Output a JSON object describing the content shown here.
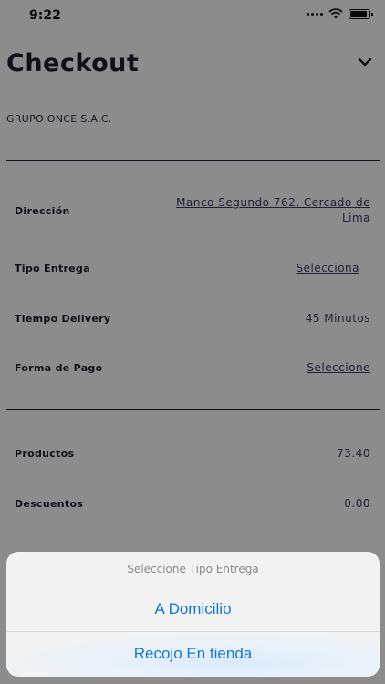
{
  "status": {
    "time": "9:22"
  },
  "header": {
    "title": "Checkout",
    "company": "GRUPO ONCE S.A.C."
  },
  "details": {
    "address_label": "Dirección",
    "address_value": "Manco Segundo 762, Cercado de Lima",
    "delivery_type_label": "Tipo Entrega",
    "delivery_type_value": "Selecciona",
    "delivery_time_label": "Tiempo Delivery",
    "delivery_time_value": "45 Minutos",
    "payment_label": "Forma de Pago",
    "payment_value": "Seleccione"
  },
  "summary": {
    "products_label": "Productos",
    "products_value": "73.40",
    "discounts_label": "Descuentos",
    "discounts_value": "0.00"
  },
  "action_sheet": {
    "title": "Seleccione Tipo Entrega",
    "options": [
      "A Domicilio",
      "Recojo En tienda"
    ]
  },
  "colors": {
    "accent": "#1377d9",
    "overlay": "rgba(0,0,0,0.45)"
  }
}
